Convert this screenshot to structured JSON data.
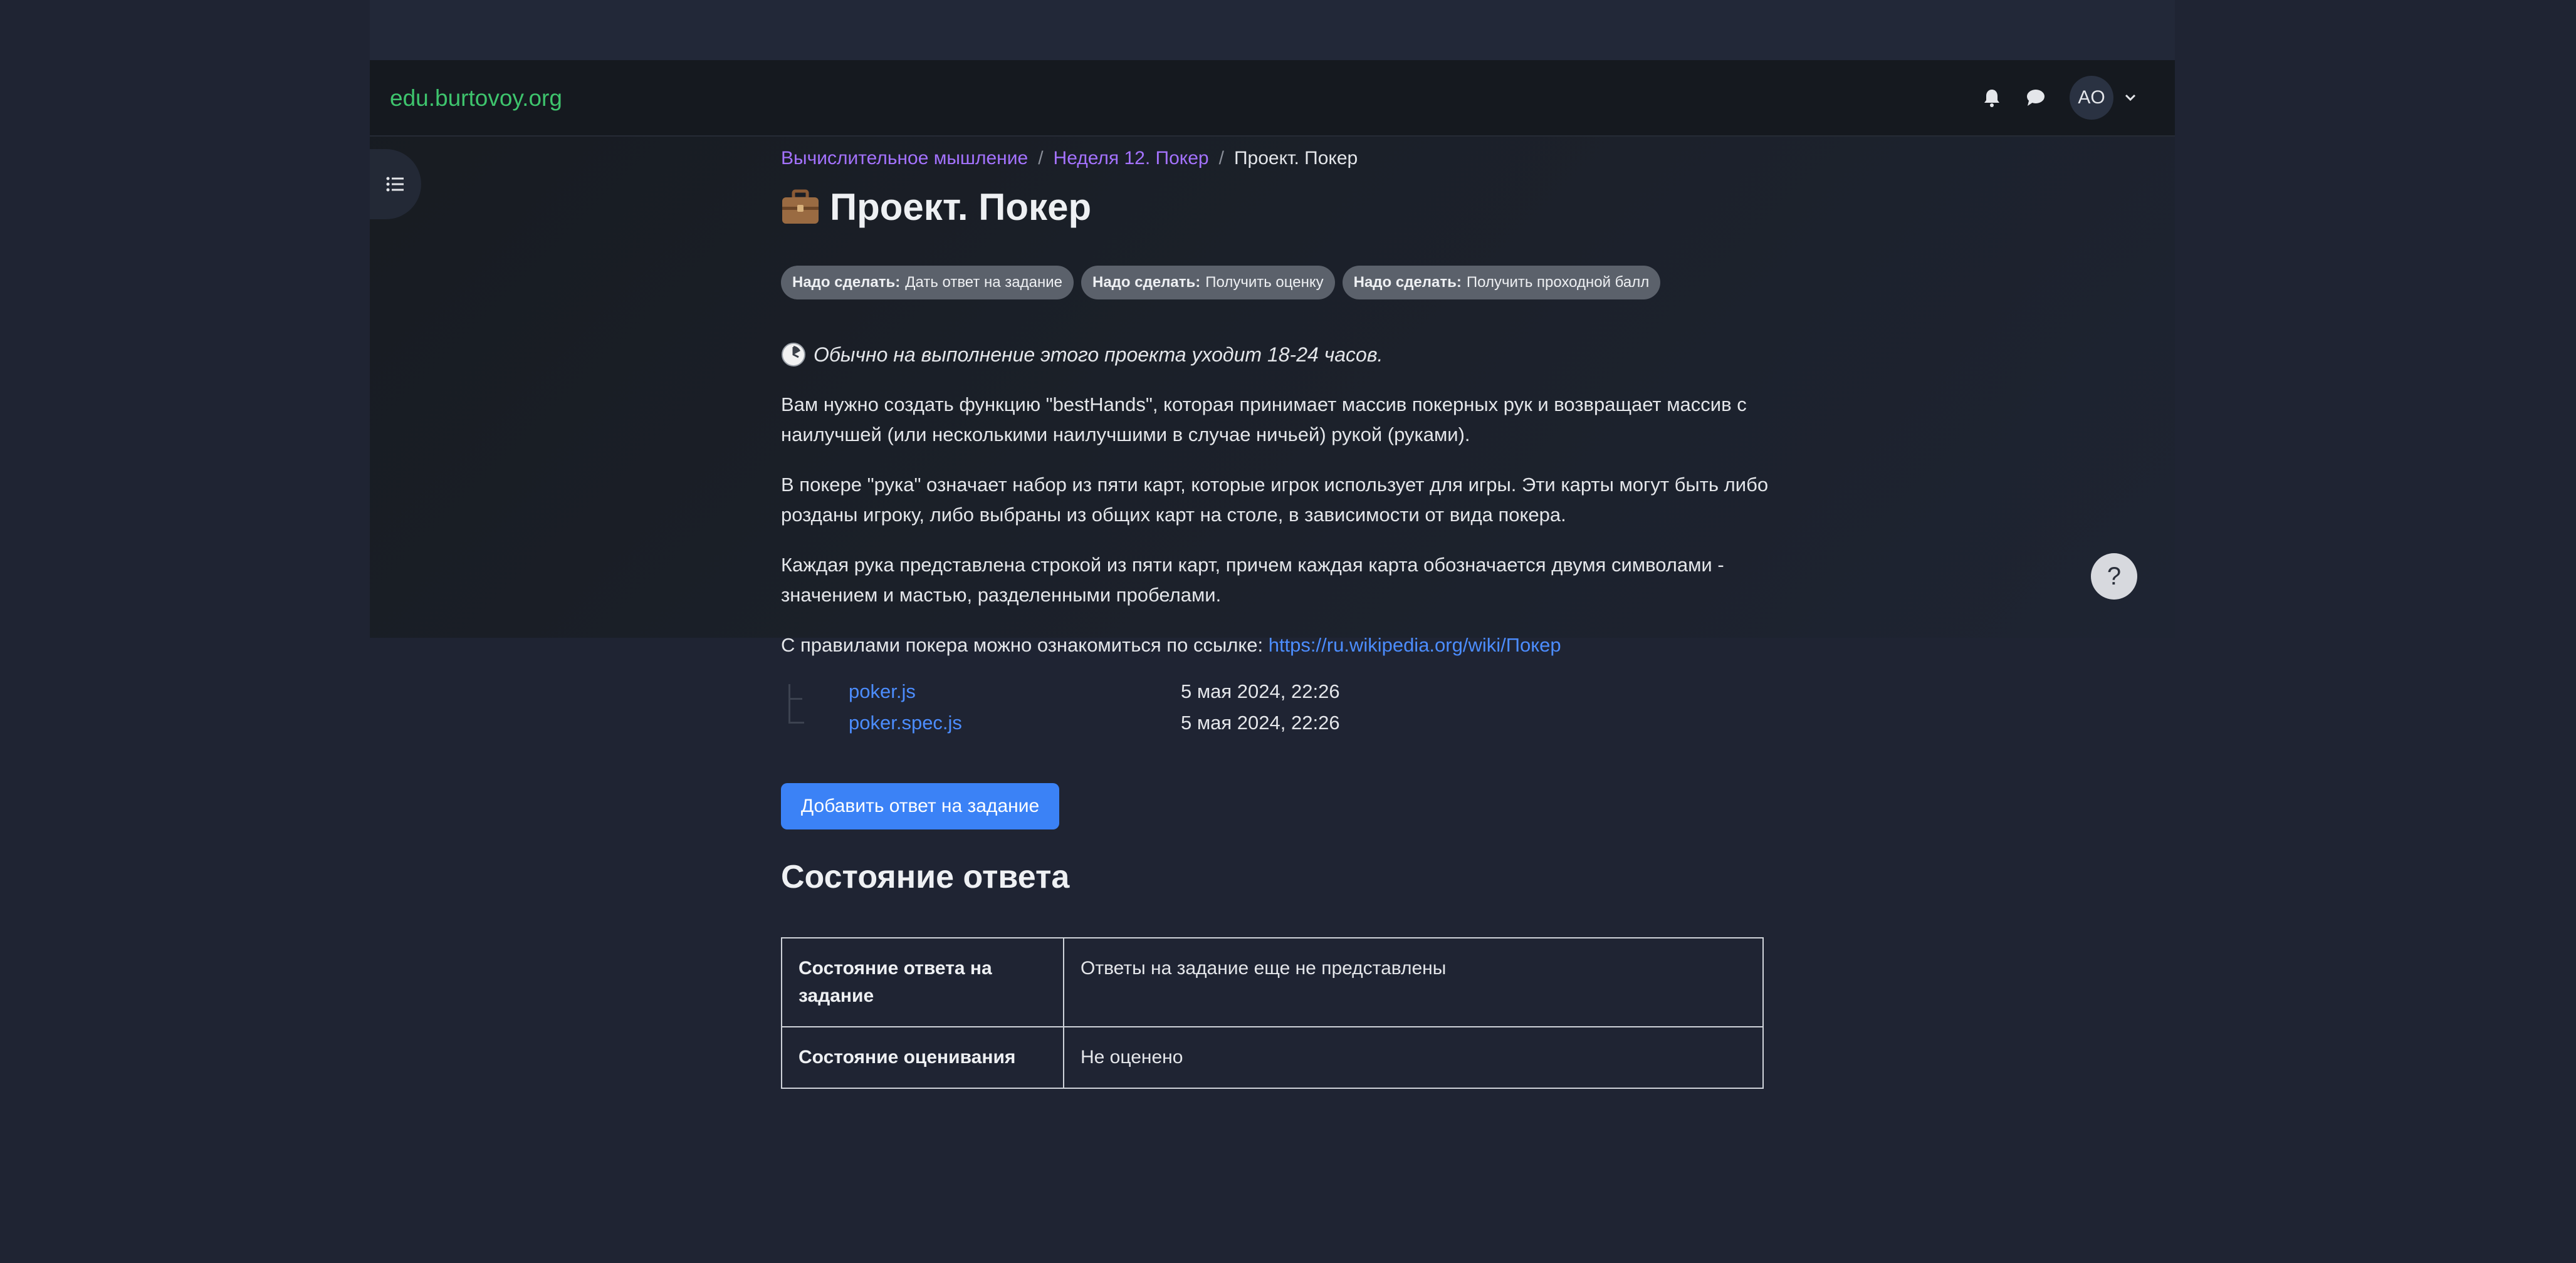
{
  "navbar": {
    "brand": "edu.burtovoy.org",
    "avatar_initials": "AO"
  },
  "breadcrumb": {
    "items": [
      "Вычислительное мышление",
      "Неделя 12. Покер"
    ],
    "current": "Проект. Покер"
  },
  "page": {
    "title": "Проект. Покер",
    "badges": [
      {
        "label": "Надо сделать:",
        "text": "Дать ответ на задание"
      },
      {
        "label": "Надо сделать:",
        "text": "Получить оценку"
      },
      {
        "label": "Надо сделать:",
        "text": "Получить проходной балл"
      }
    ],
    "estimate": "Обычно на выполнение этого проекта уходит 18-24 часов.",
    "paragraphs": [
      "Вам нужно создать функцию \"bestHands\", которая принимает массив покерных рук и возвращает массив с наилучшей (или несколькими наилучшими в случае ничьей) рукой (руками).",
      "В покере \"рука\" означает набор из пяти карт, которые игрок использует для игры. Эти карты могут быть либо розданы игроку, либо выбраны из общих карт на столе, в зависимости от вида покера.",
      "Каждая рука представлена строкой из пяти карт, причем каждая карта обозначается двумя символами - значением и мастью, разделенными пробелами."
    ],
    "rules_text": "С правилами покера можно ознакомиться по ссылке: ",
    "rules_link": "https://ru.wikipedia.org/wiki/Покер",
    "files": [
      {
        "name": "poker.js",
        "date": "5 мая 2024, 22:26"
      },
      {
        "name": "poker.spec.js",
        "date": "5 мая 2024, 22:26"
      }
    ],
    "submit_label": "Добавить ответ на задание"
  },
  "status": {
    "heading": "Состояние ответа",
    "rows": [
      {
        "key": "Состояние ответа на задание",
        "value": "Ответы на задание еще не представлены"
      },
      {
        "key": "Состояние оценивания",
        "value": "Не оценено"
      }
    ]
  },
  "help": {
    "label": "?"
  },
  "colors": {
    "brand": "#3ec46d",
    "link": "#4c8dff",
    "breadcrumb_link": "#a472ff",
    "button": "#3b82f6"
  }
}
